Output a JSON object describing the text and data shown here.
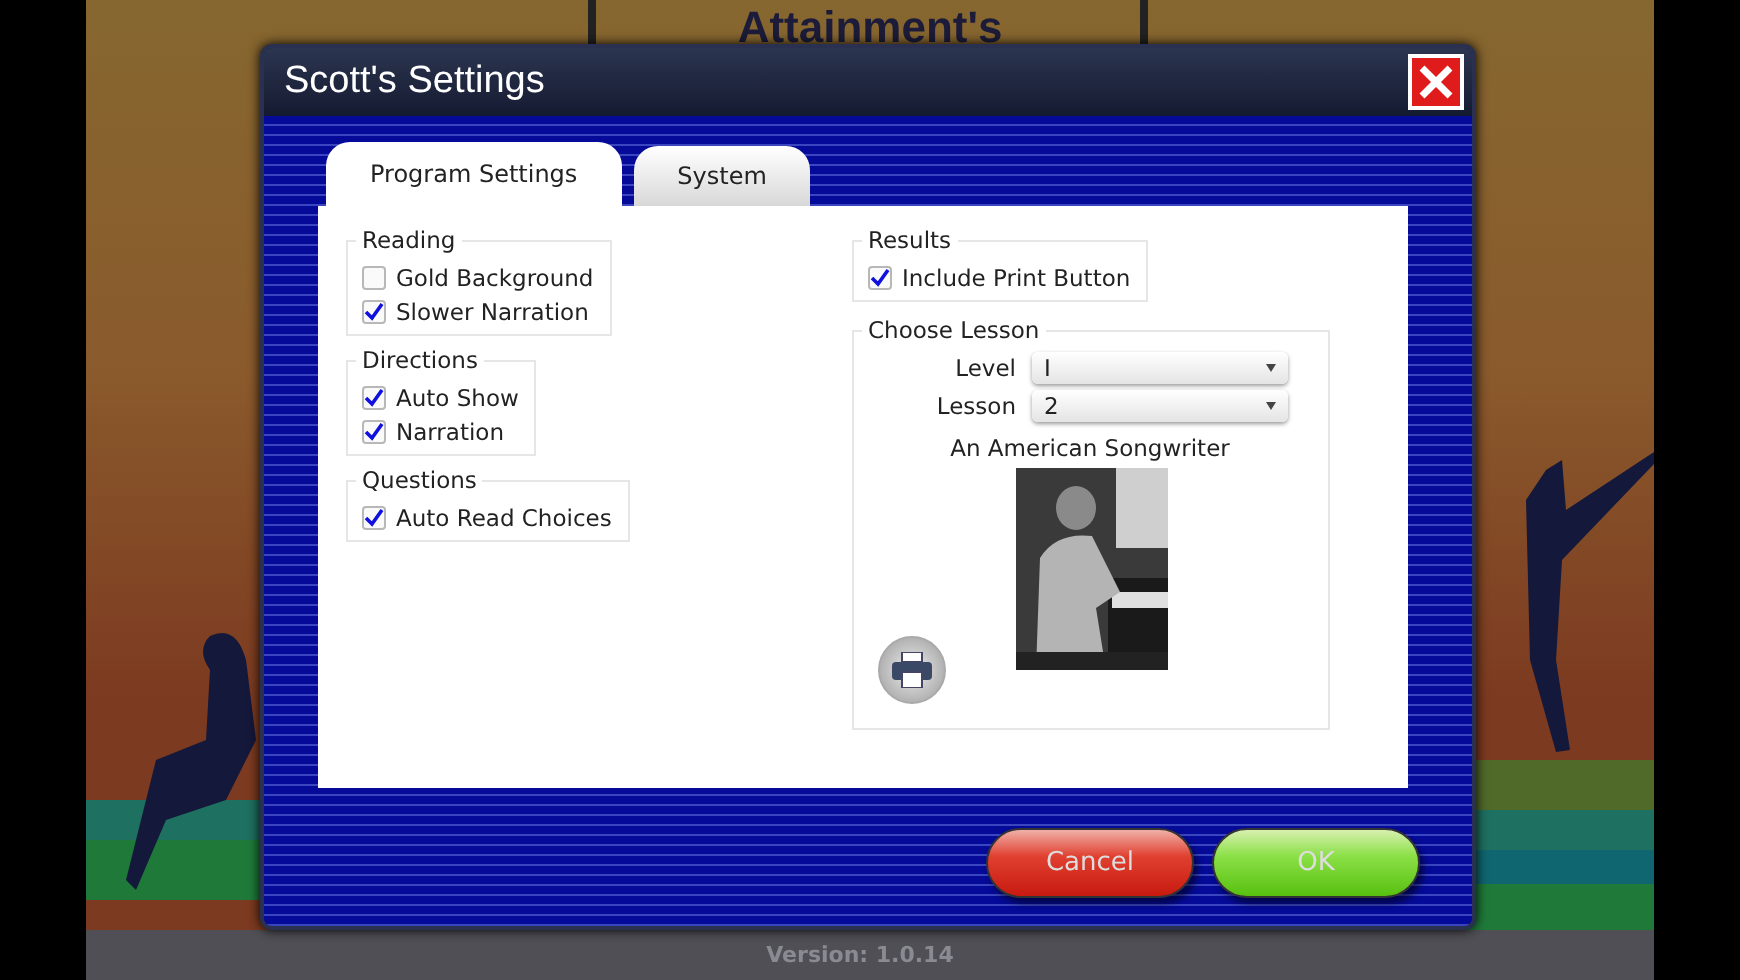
{
  "background": {
    "title": "Attainment's",
    "version": "Version: 1.0.14"
  },
  "dialog": {
    "title": "Scott's Settings",
    "tabs": [
      {
        "label": "Program Settings",
        "selected": true
      },
      {
        "label": "System",
        "selected": false
      }
    ],
    "left_groups": [
      {
        "title": "Reading",
        "items": [
          {
            "label": "Gold Background",
            "checked": false
          },
          {
            "label": "Slower Narration",
            "checked": true
          }
        ]
      },
      {
        "title": "Directions",
        "items": [
          {
            "label": "Auto Show",
            "checked": true
          },
          {
            "label": "Narration",
            "checked": true
          }
        ]
      },
      {
        "title": "Questions",
        "items": [
          {
            "label": "Auto Read Choices",
            "checked": true
          }
        ]
      }
    ],
    "results": {
      "title": "Results",
      "items": [
        {
          "label": "Include Print Button",
          "checked": true
        }
      ]
    },
    "choose_lesson": {
      "title": "Choose Lesson",
      "fields": [
        {
          "label": "Level",
          "value": "I"
        },
        {
          "label": "Lesson",
          "value": "2"
        }
      ],
      "caption": "An American Songwriter"
    },
    "buttons": [
      {
        "label": "Cancel",
        "kind": "cancel"
      },
      {
        "label": "OK",
        "kind": "ok"
      }
    ]
  }
}
